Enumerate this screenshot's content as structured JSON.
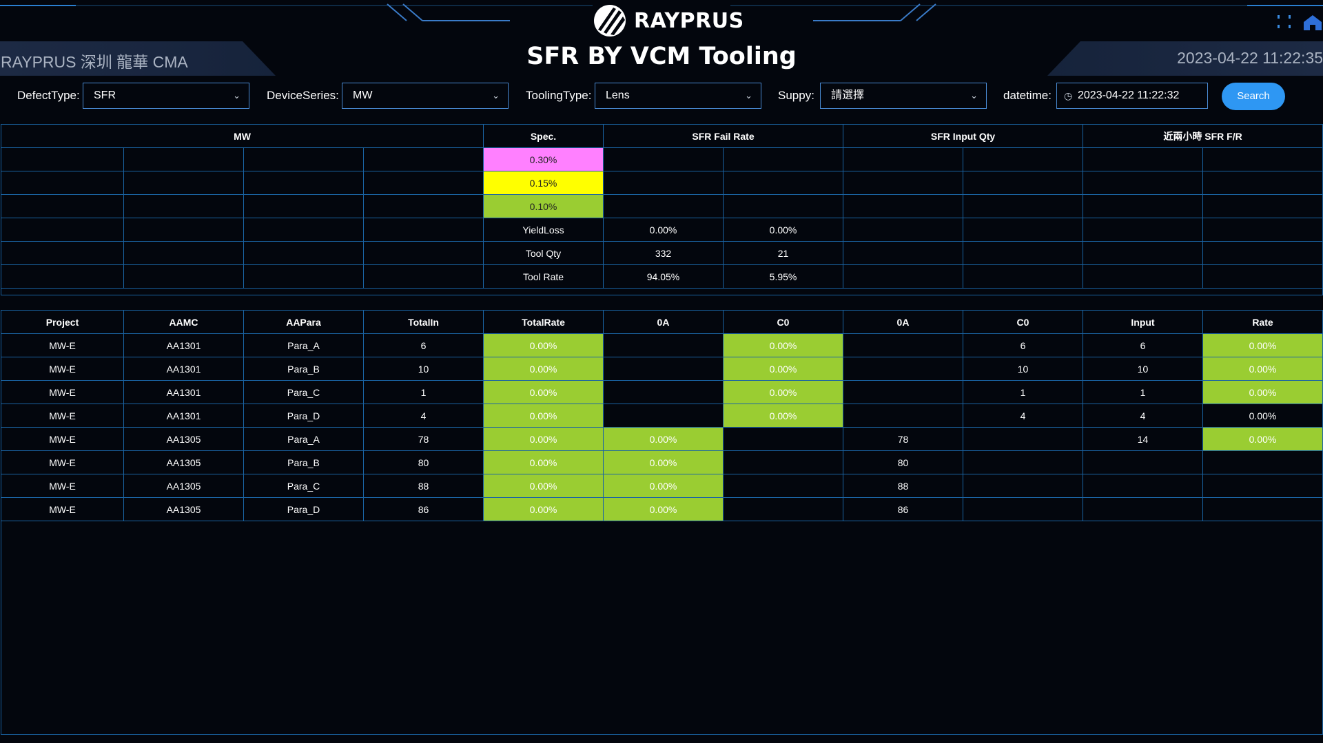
{
  "brand": {
    "logo_text": "RAYPRUS"
  },
  "header": {
    "title": "SFR BY VCM Tooling",
    "site": "RAYPRUS 深圳 龍華 CMA",
    "clock": "2023-04-22 11:22:35"
  },
  "filters": {
    "defect_type": {
      "label": "DefectType:",
      "value": "SFR"
    },
    "device_series": {
      "label": "DeviceSeries:",
      "value": "MW"
    },
    "tooling_type": {
      "label": "ToolingType:",
      "value": "Lens"
    },
    "suppy": {
      "label": "Suppy:",
      "value": "請選擇"
    },
    "datetime": {
      "label": "datetime:",
      "value": "2023-04-22 11:22:32"
    },
    "search_label": "Search"
  },
  "summary": {
    "headers": [
      "MW",
      "Spec.",
      "SFR Fail Rate",
      "SFR Input Qty",
      "近兩小時 SFR F/R"
    ],
    "spec_rows": [
      {
        "value": "0.30%",
        "color": "#ff80ff"
      },
      {
        "value": "0.15%",
        "color": "#ffff00"
      },
      {
        "value": "0.10%",
        "color": "#9acd32"
      }
    ],
    "stat_rows": [
      {
        "label": "YieldLoss",
        "a": "0.00%",
        "b": "0.00%"
      },
      {
        "label": "Tool Qty",
        "a": "332",
        "b": "21"
      },
      {
        "label": "Tool Rate",
        "a": "94.05%",
        "b": "5.95%"
      }
    ]
  },
  "detail": {
    "columns": [
      "Project",
      "AAMC",
      "AAPara",
      "TotalIn",
      "TotalRate",
      "0A",
      "C0",
      "0A",
      "C0",
      "Input",
      "Rate"
    ],
    "rows": [
      [
        "MW-E",
        "AA1301",
        "Para_A",
        "6",
        "0.00%",
        "",
        "0.00%",
        "",
        "6",
        "6",
        "0.00%"
      ],
      [
        "MW-E",
        "AA1301",
        "Para_B",
        "10",
        "0.00%",
        "",
        "0.00%",
        "",
        "10",
        "10",
        "0.00%"
      ],
      [
        "MW-E",
        "AA1301",
        "Para_C",
        "1",
        "0.00%",
        "",
        "0.00%",
        "",
        "1",
        "1",
        "0.00%"
      ],
      [
        "MW-E",
        "AA1301",
        "Para_D",
        "4",
        "0.00%",
        "",
        "0.00%",
        "",
        "4",
        "4",
        "0.00%"
      ],
      [
        "MW-E",
        "AA1305",
        "Para_A",
        "78",
        "0.00%",
        "0.00%",
        "",
        "78",
        "",
        "14",
        "0.00%"
      ],
      [
        "MW-E",
        "AA1305",
        "Para_B",
        "80",
        "0.00%",
        "0.00%",
        "",
        "80",
        "",
        "",
        ""
      ],
      [
        "MW-E",
        "AA1305",
        "Para_C",
        "88",
        "0.00%",
        "0.00%",
        "",
        "88",
        "",
        "",
        ""
      ],
      [
        "MW-E",
        "AA1305",
        "Para_D",
        "86",
        "0.00%",
        "0.00%",
        "",
        "86",
        "",
        "",
        ""
      ]
    ],
    "green_cells": [
      [
        1,
        1,
        0,
        1,
        0,
        0,
        0,
        0,
        0,
        0,
        1
      ],
      [
        1,
        1,
        0,
        1,
        0,
        0,
        0,
        0,
        0,
        0,
        1
      ],
      [
        1,
        1,
        0,
        1,
        0,
        0,
        0,
        0,
        0,
        0,
        1
      ],
      [
        1,
        1,
        0,
        1,
        0,
        0,
        0,
        0,
        0,
        0,
        0
      ],
      [
        1,
        1,
        1,
        0,
        0,
        0,
        0,
        0,
        0,
        0,
        1
      ],
      [
        1,
        1,
        1,
        0,
        0,
        0,
        0,
        0,
        0,
        0,
        0
      ],
      [
        1,
        1,
        1,
        0,
        0,
        0,
        0,
        0,
        0,
        0,
        0
      ],
      [
        1,
        1,
        1,
        0,
        0,
        0,
        0,
        0,
        0,
        0,
        0
      ]
    ]
  },
  "colors": {
    "accent": "#2e97f3",
    "border": "#1a64a4",
    "pass": "#9acd32",
    "background": "#03060d"
  },
  "icons": {
    "logo": "rayprus-logo-icon",
    "grid": "grid-icon",
    "home": "home-icon",
    "chevron": "chevron-down-icon",
    "clock": "clock-icon"
  }
}
